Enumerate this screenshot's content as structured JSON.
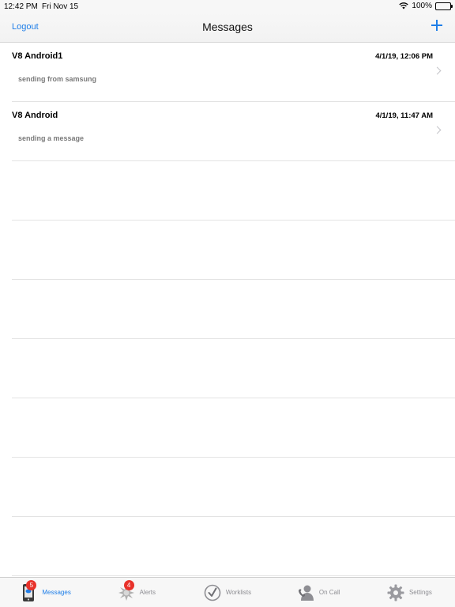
{
  "status_bar": {
    "time": "12:42 PM",
    "date": "Fri Nov 15",
    "battery": "100%"
  },
  "nav": {
    "logout": "Logout",
    "title": "Messages"
  },
  "messages": [
    {
      "sender": "V8 Android1",
      "timestamp": "4/1/19, 12:06 PM",
      "preview": "sending from samsung"
    },
    {
      "sender": "V8 Android",
      "timestamp": "4/1/19, 11:47 AM",
      "preview": "sending a message"
    }
  ],
  "tabs": [
    {
      "label": "Messages",
      "icon": "messages-phone-icon",
      "badge": "5",
      "active": true
    },
    {
      "label": "Alerts",
      "icon": "alert-burst-icon",
      "badge": "4",
      "active": false
    },
    {
      "label": "Worklists",
      "icon": "checkmark-circle-icon",
      "badge": "",
      "active": false
    },
    {
      "label": "On Call",
      "icon": "on-call-person-icon",
      "badge": "",
      "active": false
    },
    {
      "label": "Settings",
      "icon": "gear-icon",
      "badge": "",
      "active": false
    }
  ],
  "colors": {
    "accent": "#1e7ee8",
    "badge": "#e8322b",
    "inactive": "#8e8e93"
  }
}
